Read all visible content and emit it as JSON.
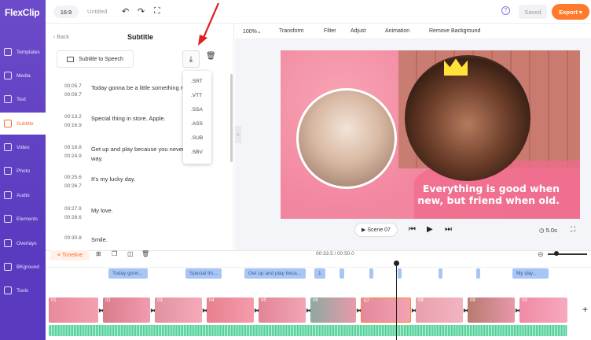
{
  "app": {
    "logo": "FlexClip"
  },
  "sidebar": {
    "items": [
      {
        "label": "Templates"
      },
      {
        "label": "Media"
      },
      {
        "label": "Text"
      },
      {
        "label": "Subtitle"
      },
      {
        "label": "Video"
      },
      {
        "label": "Photo"
      },
      {
        "label": "Audio"
      },
      {
        "label": "Elements"
      },
      {
        "label": "Overlays"
      },
      {
        "label": "BKground"
      },
      {
        "label": "Tools"
      }
    ],
    "active": "Subtitle"
  },
  "topbar": {
    "ratio": "16:9",
    "project_title": "Untitled",
    "saved": "Saved",
    "export": "Export",
    "help": "?"
  },
  "panel": {
    "back": "Back",
    "title": "Subtitle",
    "tts": "Subtitle to Speech",
    "formats": [
      ".SRT",
      ".VTT",
      ".SSA",
      ".ASS",
      ".SUB",
      ".SBV"
    ],
    "rows": [
      {
        "start": "00:05.7",
        "end": "00:09.7",
        "text": "Today gonna be a little something n"
      },
      {
        "start": "00:13.2",
        "end": "00:16.9",
        "text": "Special thing in store. Apple."
      },
      {
        "start": "00:18.8",
        "end": "00:24.9",
        "text": "Get up and play because you never way."
      },
      {
        "start": "00:25.6",
        "end": "00:26.7",
        "text": "It's my lucky day."
      },
      {
        "start": "00:27.9",
        "end": "00:28.6",
        "text": "My love."
      },
      {
        "start": "00:30.8",
        "end": "",
        "text": "Smile."
      }
    ]
  },
  "preview": {
    "zoom": "100%",
    "menu": [
      "Transform",
      "Filter",
      "Adjust",
      "Animation",
      "Remove Background"
    ],
    "caption_line1": "Everything is good when",
    "caption_line2": "new, but friend when old.",
    "scene": "Scene 07",
    "duration": "5.0s"
  },
  "timeline": {
    "label": "Timeline",
    "time": "00:33.5 / 00:50.0",
    "subtitles": [
      "Today gonn...",
      "Special thi...",
      "Get up and play beca...",
      "1",
      "My day..."
    ],
    "clips": [
      "01",
      "02",
      "03",
      "04",
      "05",
      "06",
      "07",
      "08",
      "09",
      "10"
    ]
  },
  "colors": {
    "accent": "#ff7a2c",
    "sidebar": "#5a3bbf",
    "subtitle_chip": "#a9c5f5",
    "audio": "#3ec88f"
  }
}
